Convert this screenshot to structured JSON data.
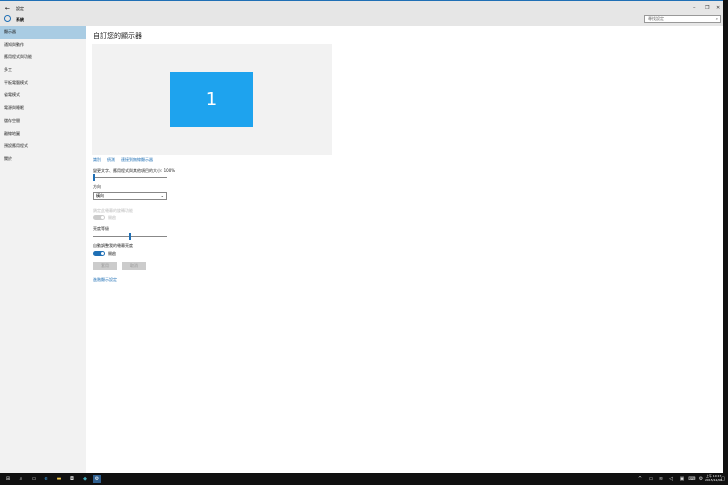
{
  "window": {
    "title": "設定",
    "section": "系統",
    "search_placeholder": "尋找設定",
    "min": "–",
    "max": "❐",
    "close": "✕",
    "back": "←"
  },
  "sidebar": {
    "items": [
      {
        "label": "顯示器"
      },
      {
        "label": "通知與動作"
      },
      {
        "label": "應用程式與功能"
      },
      {
        "label": "多工"
      },
      {
        "label": "平板電腦模式"
      },
      {
        "label": "省電模式"
      },
      {
        "label": "電源與睡眠"
      },
      {
        "label": "儲存空間"
      },
      {
        "label": "離線地圖"
      },
      {
        "label": "預設應用程式"
      },
      {
        "label": "關於"
      }
    ]
  },
  "main": {
    "title": "自訂您的顯示器",
    "monitor_number": "1",
    "links": [
      "識別",
      "偵測",
      "連接到無線顯示器"
    ],
    "scale_label": "變更文字、應用程式與其他項目的大小: 100%",
    "scale_value": 0,
    "orientation_label": "方向",
    "orientation_value": "橫向",
    "rotation_lock_label": "鎖定此螢幕的旋轉功能",
    "rotation_lock_state": "開啟",
    "brightness_label": "亮度等級",
    "brightness_value": 50,
    "auto_brightness_label": "自動調整我的螢幕亮度",
    "auto_brightness_state": "開啟",
    "apply": "套用",
    "cancel": "取消",
    "advanced_link": "進階顯示設定"
  },
  "taskbar": {
    "time": "上午 10:17",
    "date": "2015/12/06"
  }
}
